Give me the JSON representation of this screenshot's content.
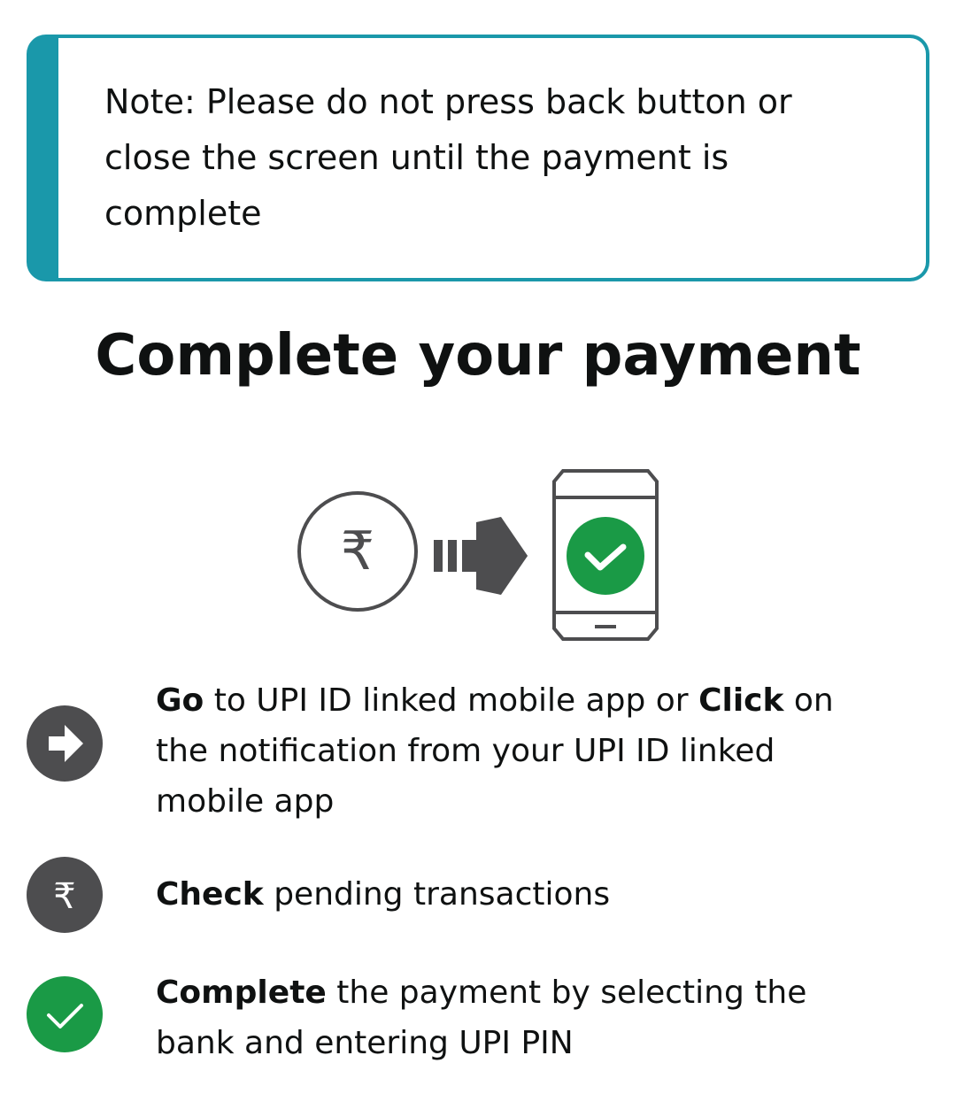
{
  "note": {
    "text": "Note: Please do not press back button or close the screen until the payment is complete"
  },
  "title": "Complete your payment",
  "illustration": {
    "rupee_symbol": "₹",
    "icons": [
      "rupee-circle-icon",
      "arrow-right-icon",
      "phone-check-icon"
    ]
  },
  "steps": [
    {
      "icon": "arrow-right-icon",
      "bold_1": "Go",
      "text_1": " to UPI ID linked mobile app or ",
      "bold_2": "Click",
      "text_2": " on the notification from your UPI ID linked mobile app"
    },
    {
      "icon": "rupee-icon",
      "bold_1": "Check",
      "text_1": " pending transactions"
    },
    {
      "icon": "checkmark-icon",
      "bold_1": "Complete",
      "text_1": " the payment by selecting the bank and entering UPI PIN"
    }
  ],
  "colors": {
    "accent_teal": "#1a98aa",
    "icon_gray": "#4d4d4f",
    "success_green": "#1a9a46",
    "text": "#0f1111"
  }
}
